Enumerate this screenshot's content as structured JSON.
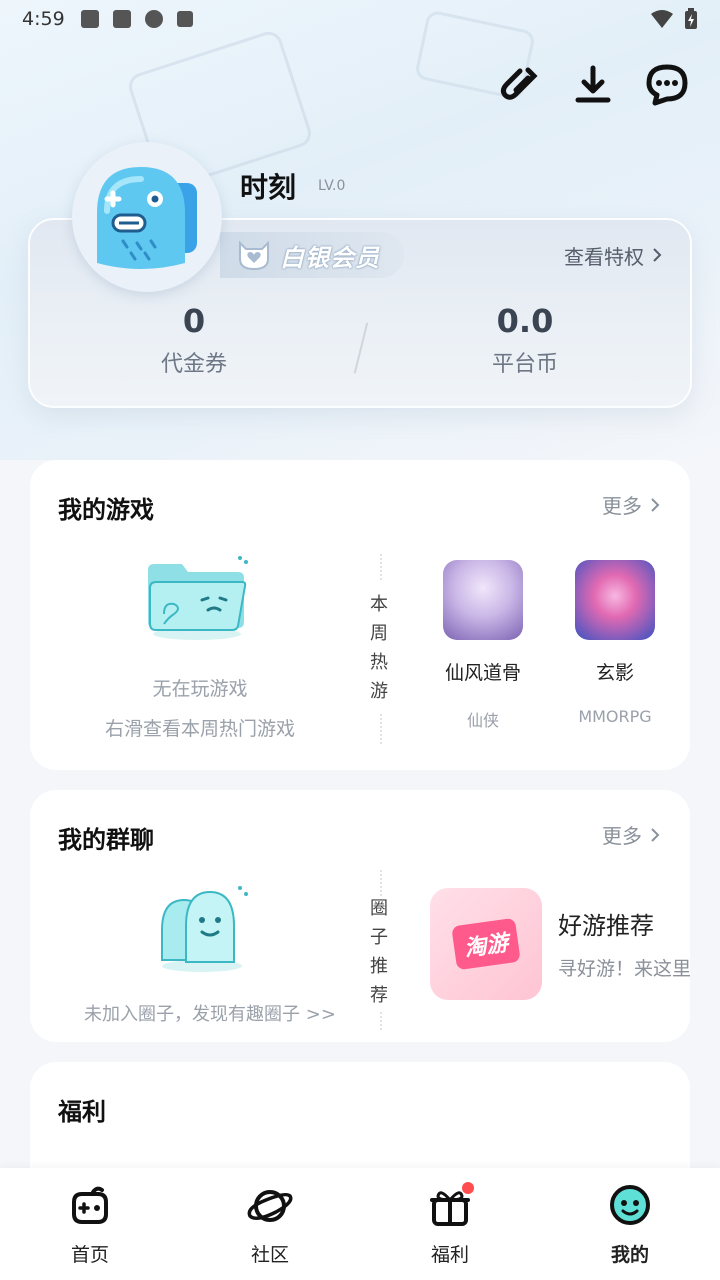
{
  "status_bar": {
    "time": "4:59"
  },
  "profile": {
    "nickname": "时刻",
    "level": "LV.0",
    "vip_name": "白银会员",
    "vip_privilege": "查看特权",
    "stats": [
      {
        "value": "0",
        "label": "代金券"
      },
      {
        "value": "0.0",
        "label": "平台币"
      }
    ]
  },
  "my_games": {
    "title": "我的游戏",
    "more": "更多",
    "empty_title": "无在玩游戏",
    "empty_hint": "右滑查看本周热门游戏",
    "side_tag": [
      "本",
      "周",
      "热",
      "游"
    ],
    "games": [
      {
        "name": "仙风道骨",
        "tag": "仙侠",
        "color_a": "#c9b6e6",
        "color_b": "#7d63b3"
      },
      {
        "name": "玄影",
        "tag": "MMORPG",
        "color_a": "#e26ab2",
        "color_b": "#3a52c2"
      }
    ]
  },
  "my_groups": {
    "title": "我的群聊",
    "more": "更多",
    "empty_hint": "未加入圈子，发现有趣圈子 >>",
    "side_tag": [
      "圈",
      "子",
      "推",
      "荐"
    ],
    "recommend": {
      "cover_label": "淘游",
      "name": "好游推荐",
      "desc": "寻好游！来这里"
    }
  },
  "welfare": {
    "title": "福利"
  },
  "bottom_nav": {
    "items": [
      {
        "label": "首页",
        "icon": "gamepad-icon"
      },
      {
        "label": "社区",
        "icon": "planet-icon"
      },
      {
        "label": "福利",
        "icon": "gift-icon"
      },
      {
        "label": "我的",
        "icon": "face-icon"
      }
    ],
    "active_index": 3
  },
  "colors": {
    "accent": "#2ab7d6",
    "badge_red": "#ff4d4f"
  }
}
